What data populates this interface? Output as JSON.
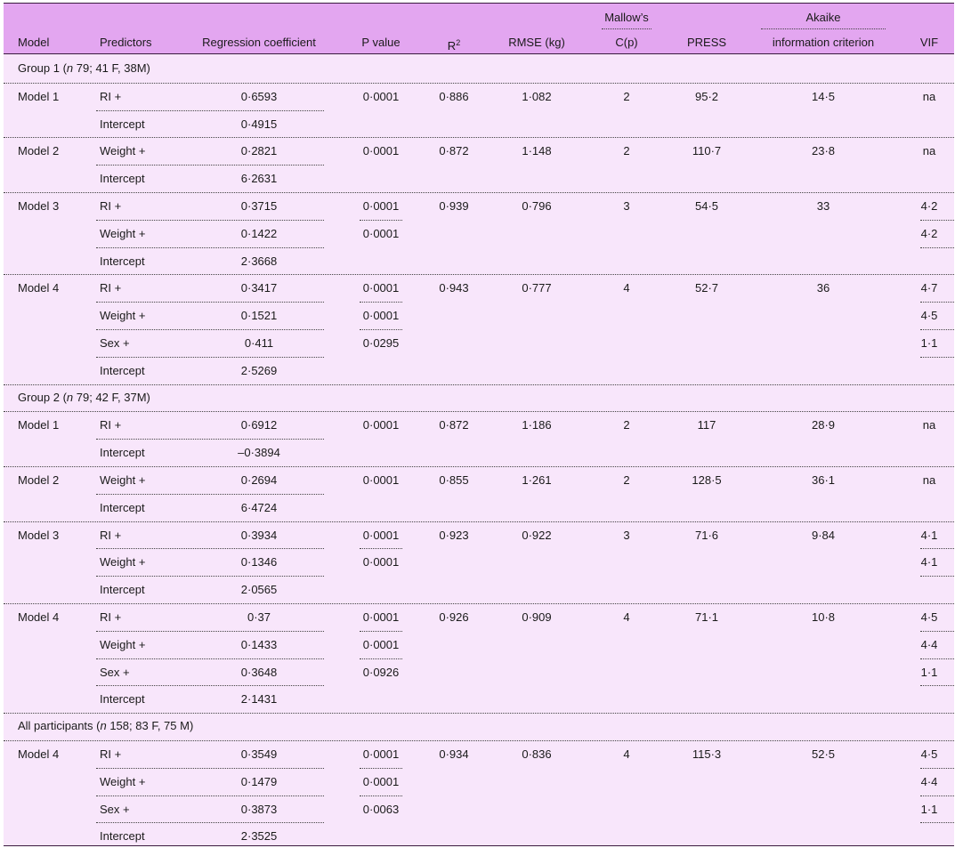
{
  "header": {
    "model": "Model",
    "predictors": "Predictors",
    "regression_coefficient": "Regression coefficient",
    "p_value": "P value",
    "r2_base": "R",
    "r2_sup": "2",
    "rmse": "RMSE (kg)",
    "mallows_line1": "Mallow’s",
    "mallows_line2": "C(p)",
    "press": "PRESS",
    "akaike_line1": "Akaike",
    "akaike_line2": "information criterion",
    "vif": "VIF"
  },
  "groups": [
    {
      "label_prefix": "Group 1 (",
      "label_n": "n",
      "label_suffix": " 79; 41 F, 38M)",
      "models": [
        {
          "name": "Model 1",
          "r2": "0·886",
          "rmse": "1·082",
          "cp": "2",
          "press": "95·2",
          "aic": "14·5",
          "rows": [
            {
              "pred": "RI +",
              "coef": "0·6593",
              "p": "0·0001",
              "vif": "na"
            },
            {
              "pred": "Intercept",
              "coef": "0·4915",
              "p": "",
              "vif": ""
            }
          ]
        },
        {
          "name": "Model 2",
          "r2": "0·872",
          "rmse": "1·148",
          "cp": "2",
          "press": "110·7",
          "aic": "23·8",
          "rows": [
            {
              "pred": "Weight +",
              "coef": "0·2821",
              "p": "0·0001",
              "vif": "na"
            },
            {
              "pred": "Intercept",
              "coef": "6·2631",
              "p": "",
              "vif": ""
            }
          ]
        },
        {
          "name": "Model 3",
          "r2": "0·939",
          "rmse": "0·796",
          "cp": "3",
          "press": "54·5",
          "aic": "33",
          "rows": [
            {
              "pred": "RI +",
              "coef": "0·3715",
              "p": "0·0001",
              "vif": "4·2"
            },
            {
              "pred": "Weight +",
              "coef": "0·1422",
              "p": "0·0001",
              "vif": "4·2"
            },
            {
              "pred": "Intercept",
              "coef": "2·3668",
              "p": "",
              "vif": ""
            }
          ]
        },
        {
          "name": "Model 4",
          "r2": "0·943",
          "rmse": "0·777",
          "cp": "4",
          "press": "52·7",
          "aic": "36",
          "rows": [
            {
              "pred": "RI +",
              "coef": "0·3417",
              "p": "0·0001",
              "vif": "4·7"
            },
            {
              "pred": "Weight +",
              "coef": "0·1521",
              "p": "0·0001",
              "vif": "4·5"
            },
            {
              "pred": "Sex +",
              "coef": "0·411",
              "p": "0·0295",
              "vif": "1·1"
            },
            {
              "pred": "Intercept",
              "coef": "2·5269",
              "p": "",
              "vif": ""
            }
          ]
        }
      ]
    },
    {
      "label_prefix": "Group 2 (",
      "label_n": "n",
      "label_suffix": " 79; 42 F, 37M)",
      "models": [
        {
          "name": "Model 1",
          "r2": "0·872",
          "rmse": "1·186",
          "cp": "2",
          "press": "117",
          "aic": "28·9",
          "rows": [
            {
              "pred": "RI +",
              "coef": "0·6912",
              "p": "0·0001",
              "vif": "na"
            },
            {
              "pred": "Intercept",
              "coef": "–0·3894",
              "p": "",
              "vif": ""
            }
          ]
        },
        {
          "name": "Model 2",
          "r2": "0·855",
          "rmse": "1·261",
          "cp": "2",
          "press": "128·5",
          "aic": "36·1",
          "rows": [
            {
              "pred": "Weight +",
              "coef": "0·2694",
              "p": "0·0001",
              "vif": "na"
            },
            {
              "pred": "Intercept",
              "coef": "6·4724",
              "p": "",
              "vif": ""
            }
          ]
        },
        {
          "name": "Model 3",
          "r2": "0·923",
          "rmse": "0·922",
          "cp": "3",
          "press": "71·6",
          "aic": "9·84",
          "rows": [
            {
              "pred": "RI +",
              "coef": "0·3934",
              "p": "0·0001",
              "vif": "4·1"
            },
            {
              "pred": "Weight +",
              "coef": "0·1346",
              "p": "0·0001",
              "vif": "4·1"
            },
            {
              "pred": "Intercept",
              "coef": "2·0565",
              "p": "",
              "vif": ""
            }
          ]
        },
        {
          "name": "Model 4",
          "r2": "0·926",
          "rmse": "0·909",
          "cp": "4",
          "press": "71·1",
          "aic": "10·8",
          "rows": [
            {
              "pred": "RI +",
              "coef": "0·37",
              "p": "0·0001",
              "vif": "4·5"
            },
            {
              "pred": "Weight +",
              "coef": "0·1433",
              "p": "0·0001",
              "vif": "4·4"
            },
            {
              "pred": "Sex +",
              "coef": "0·3648",
              "p": "0·0926",
              "vif": "1·1"
            },
            {
              "pred": "Intercept",
              "coef": "2·1431",
              "p": "",
              "vif": ""
            }
          ]
        }
      ]
    },
    {
      "label_prefix": "All participants (",
      "label_n": "n",
      "label_suffix": " 158; 83 F, 75 M)",
      "models": [
        {
          "name": "Model 4",
          "r2": "0·934",
          "rmse": "0·836",
          "cp": "4",
          "press": "115·3",
          "aic": "52·5",
          "rows": [
            {
              "pred": "RI +",
              "coef": "0·3549",
              "p": "0·0001",
              "vif": "4·5"
            },
            {
              "pred": "Weight +",
              "coef": "0·1479",
              "p": "0·0001",
              "vif": "4·4"
            },
            {
              "pred": "Sex +",
              "coef": "0·3873",
              "p": "0·0063",
              "vif": "1·1"
            },
            {
              "pred": "Intercept",
              "coef": "2·3525",
              "p": "",
              "vif": ""
            }
          ]
        }
      ]
    }
  ],
  "colors": {
    "header_bg": "#e3a6f0",
    "body_bg": "#f8e6fb",
    "rule": "#3a1a3f"
  }
}
